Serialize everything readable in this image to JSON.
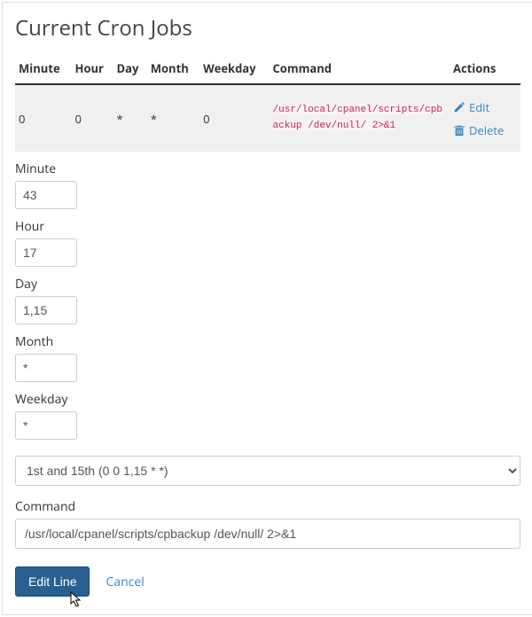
{
  "heading": "Current Cron Jobs",
  "table": {
    "headers": {
      "minute": "Minute",
      "hour": "Hour",
      "day": "Day",
      "month": "Month",
      "weekday": "Weekday",
      "command": "Command",
      "actions": "Actions"
    },
    "row": {
      "minute": "0",
      "hour": "0",
      "day": "*",
      "month": "*",
      "weekday": "0",
      "command": "/usr/local/cpanel/scripts/cpbackup /dev/null/ 2>&1"
    },
    "edit_label": "Edit",
    "delete_label": "Delete"
  },
  "form": {
    "minute": {
      "label": "Minute",
      "value": "43"
    },
    "hour": {
      "label": "Hour",
      "value": "17"
    },
    "day": {
      "label": "Day",
      "value": "1,15"
    },
    "month": {
      "label": "Month",
      "value": "*"
    },
    "weekday": {
      "label": "Weekday",
      "value": "*"
    },
    "preset_selected": "1st and 15th (0 0 1,15 * *)",
    "command": {
      "label": "Command",
      "value": "/usr/local/cpanel/scripts/cpbackup /dev/null/ 2>&1"
    },
    "submit_label": "Edit Line",
    "cancel_label": "Cancel"
  },
  "icons": {
    "edit": "pencil-icon",
    "delete": "trash-icon"
  },
  "colors": {
    "link": "#3a84c3",
    "code": "#c7254e",
    "primary_bg": "#286090"
  }
}
